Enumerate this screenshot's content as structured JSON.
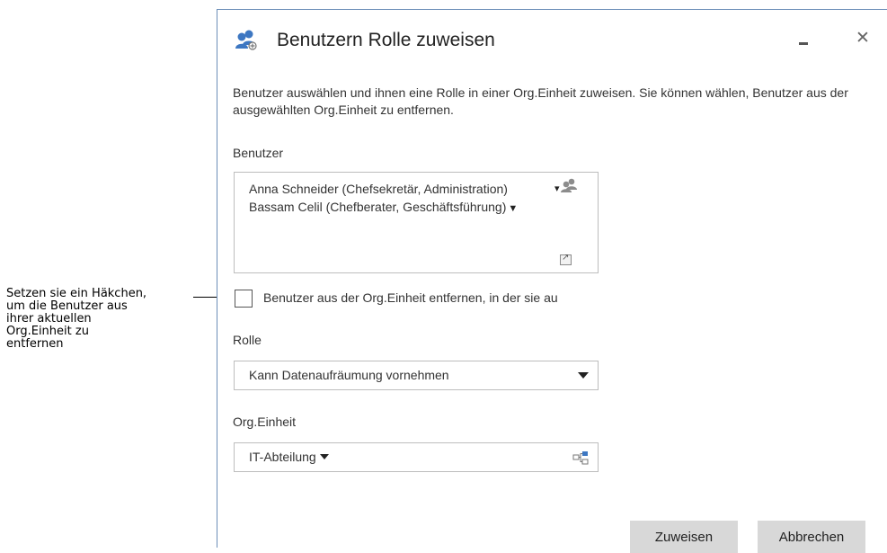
{
  "callout": {
    "lines": [
      "Setzen sie ein Häkchen,",
      "um die Benutzer aus",
      "ihrer aktuellen",
      "Org.Einheit zu",
      "entfernen"
    ]
  },
  "dialog": {
    "title": "Benutzern Rolle zuweisen",
    "title_icon": "users-icon",
    "minimize_icon": "minimize-icon",
    "close_glyph": "✕",
    "description": "Benutzer auswählen und ihnen eine Rolle in einer Org.Einheit zuweisen. Sie können wählen, Benutzer aus der ausgewählten Org.Einheit zu entfernen.",
    "users": {
      "label": "Benutzer",
      "items": [
        "Anna Schneider (Chefsekretär, Administration)",
        "Bassam Celil (Chefberater, Geschäftsführung)"
      ],
      "pick_icon": "users-icon",
      "expand_icon": "expand-icon"
    },
    "remove_checkbox": {
      "checked": false,
      "label": "Benutzer aus der Org.Einheit entfernen, in der sie au"
    },
    "role": {
      "label": "Rolle",
      "value": "Kann Datenaufräumung vornehmen"
    },
    "org_unit": {
      "label": "Org.Einheit",
      "value": "IT-Abteilung",
      "icon": "org-tree-icon"
    },
    "buttons": {
      "assign": "Zuweisen",
      "cancel": "Abbrechen"
    },
    "colors": {
      "accent": "#3d77c2",
      "border": "#6c8fb8",
      "button_bg": "#d8d8d8"
    }
  }
}
